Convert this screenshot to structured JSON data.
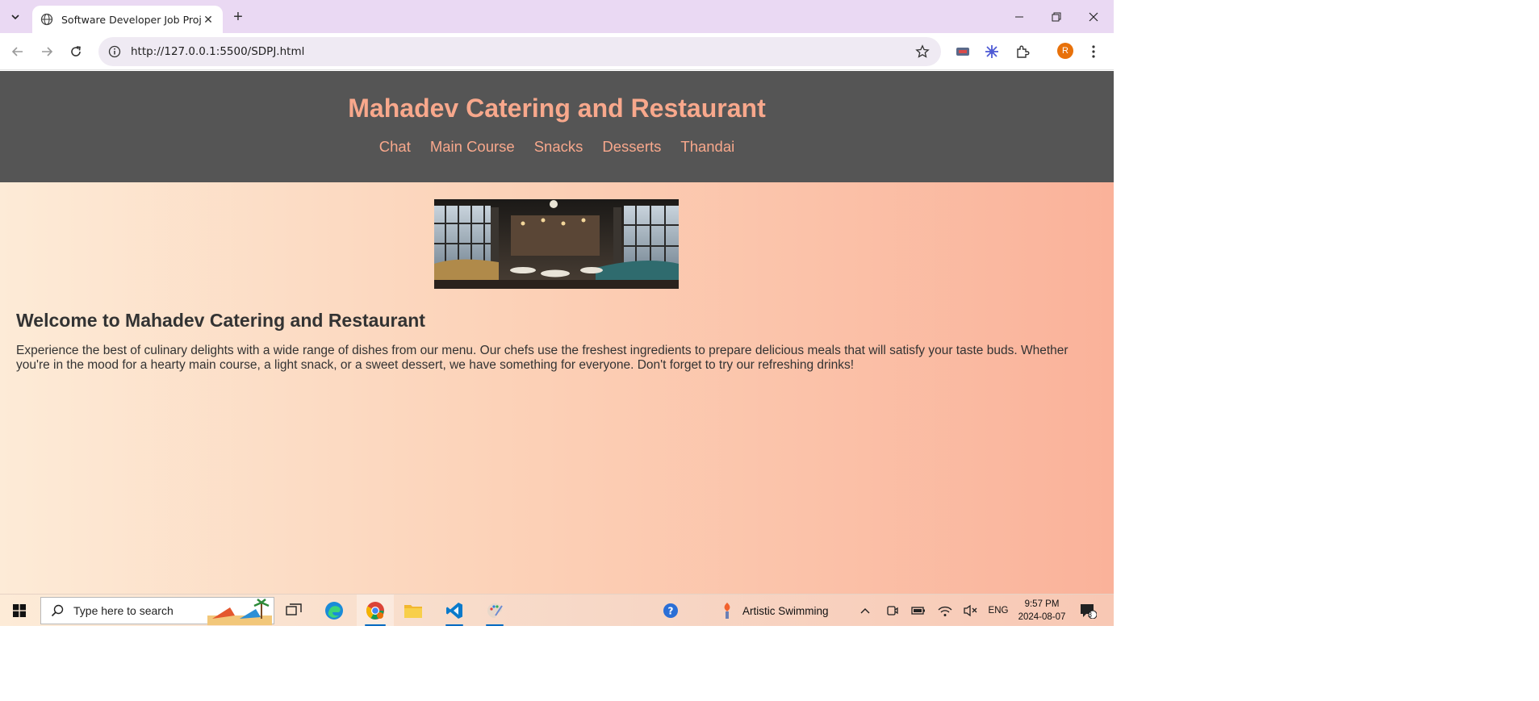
{
  "browser": {
    "tab_title": "Software Developer Job Project",
    "url": "http://127.0.0.1:5500/SDPJ.html",
    "profile_initial": "R"
  },
  "page": {
    "site_title": "Mahadev Catering and Restaurant",
    "nav": [
      "Chat",
      "Main Course",
      "Snacks",
      "Desserts",
      "Thandai"
    ],
    "welcome_heading": "Welcome to Mahadev Catering and Restaurant",
    "welcome_text": "Experience the best of culinary delights with a wide range of dishes from our menu. Our chefs use the freshest ingredients to prepare delicious meals that will satisfy your taste buds. Whether you're in the mood for a hearty main course, a light snack, or a sweet dessert, we have something for everyone. Don't forget to try our refreshing drinks!"
  },
  "taskbar": {
    "search_placeholder": "Type here to search",
    "weather_label": "Artistic Swimming",
    "language": "ENG",
    "time": "9:57 PM",
    "date": "2024-08-07",
    "notification_count": "3"
  },
  "colors": {
    "header_bg": "#555555",
    "accent_text": "#f8a88c",
    "gradient_start": "#fdebd7",
    "gradient_end": "#fab29a"
  }
}
